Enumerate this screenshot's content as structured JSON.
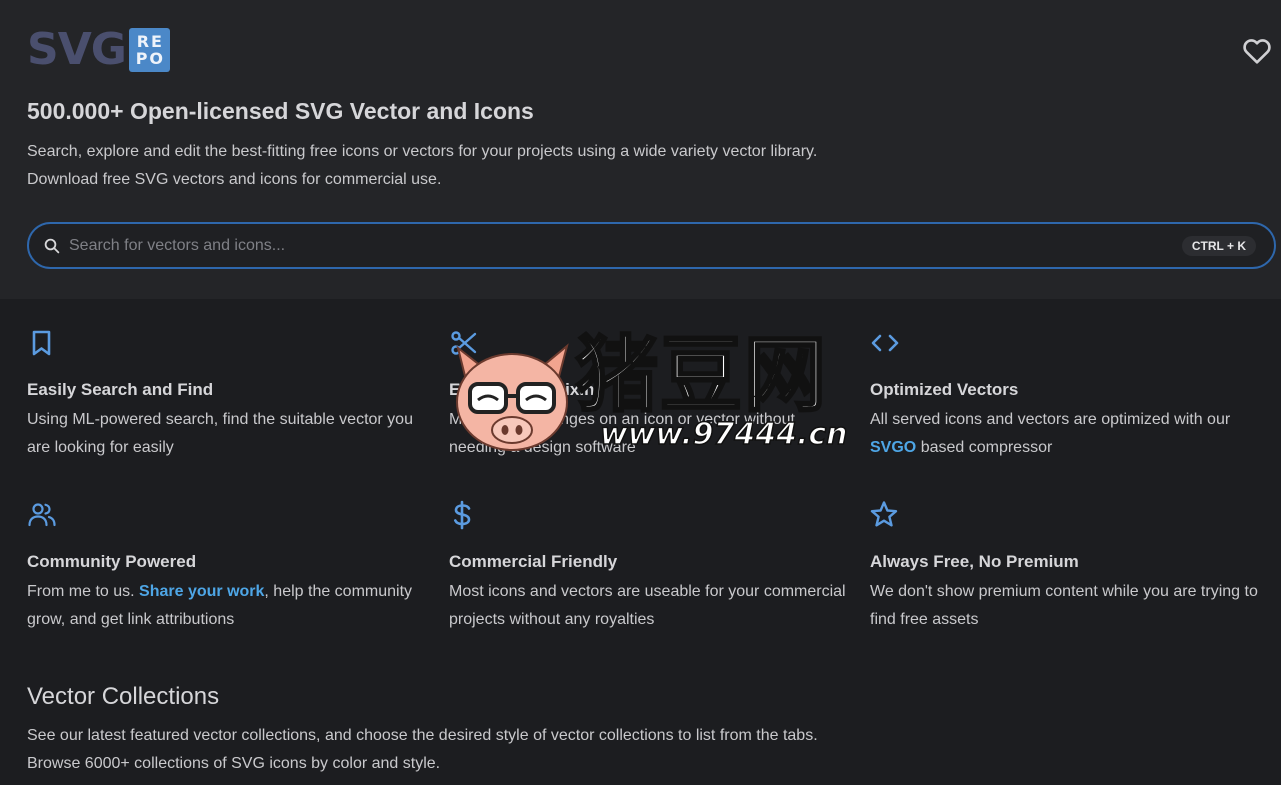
{
  "header": {
    "logo_text": "SVG",
    "logo_badge_top": "RE",
    "logo_badge_bottom": "PO",
    "headline": "500.000+ Open-licensed SVG Vector and Icons",
    "desc_line1": "Search, explore and edit the best-fitting free icons or vectors for your projects using a wide variety vector library.",
    "desc_line2": "Download free SVG vectors and icons for commercial use."
  },
  "search": {
    "placeholder": "Search for vectors and icons...",
    "value": "",
    "shortcut": "CTRL + K"
  },
  "features": [
    {
      "icon": "bookmark-icon",
      "title": "Easily Search and Find",
      "text": "Using ML-powered search, find the suitable vector you are looking for easily"
    },
    {
      "icon": "scissors-icon",
      "title": "Editing & Remixing",
      "text": "Make small changes on an icon or vector without needing a design software"
    },
    {
      "icon": "code-icon",
      "title": "Optimized Vectors",
      "text_before": "All served icons and vectors are optimized with our",
      "link": "SVGO",
      "text_after": "based compressor"
    },
    {
      "icon": "users-icon",
      "title": "Community Powered",
      "text_before": "From me to us.",
      "link": "Share your work",
      "text_after": ", help the community grow, and get link attributions"
    },
    {
      "icon": "dollar-icon",
      "title": "Commercial Friendly",
      "text": "Most icons and vectors are useable for your commercial projects without any royalties"
    },
    {
      "icon": "star-icon",
      "title": "Always Free, No Premium",
      "text": "We don't show premium content while you are trying to find free assets"
    }
  ],
  "collections": {
    "title": "Vector Collections",
    "desc_line1": "See our latest featured vector collections, and choose the desired style of vector collections to list from the tabs.",
    "desc_line2": "Browse 6000+ collections of SVG icons by color and style."
  },
  "watermark": {
    "text_main": "猪豆网",
    "text_url": "www.97444.cn"
  },
  "colors": {
    "accent": "#4b88c8",
    "link": "#4ea6e6",
    "search_border": "#2e67ac",
    "background": "#1c1d20",
    "header_background": "#242528"
  }
}
